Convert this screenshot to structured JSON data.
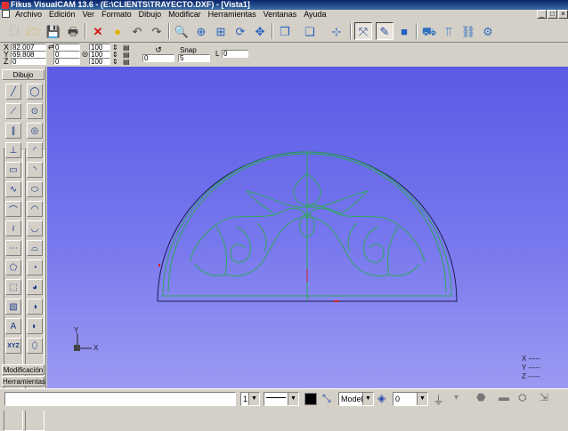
{
  "window": {
    "title": "Fikus VisualCAM 13.6 - (E:\\CLIENTS\\TRAYECTO.DXF) - [Vista1]",
    "controls": [
      "_",
      "□",
      "×"
    ]
  },
  "menu": {
    "items": [
      "Archivo",
      "Edición",
      "Ver",
      "Formato",
      "Dibujo",
      "Modificar",
      "Herramientas",
      "Ventanas",
      "Ayuda"
    ]
  },
  "coords": {
    "x_label": "X",
    "x_value": "82,007",
    "y_label": "Y",
    "y_value": "69,808",
    "z_label": "Z",
    "z_value": "0",
    "col2": [
      "0",
      "0",
      "0"
    ],
    "col3": [
      "100",
      "100",
      "100"
    ],
    "angle_value": "0",
    "snap_label": "Snap",
    "snap_value": "5",
    "l_label": "L",
    "l_value": "0"
  },
  "sidebar": {
    "top_tab": "Dibujo",
    "bottom_tabs": [
      "Modificación",
      "Herramientas"
    ]
  },
  "canvas": {
    "axis_y": "Y",
    "axis_x": "X",
    "readout": [
      "X -----",
      "Y -----",
      "Z -----"
    ]
  },
  "statusbar": {
    "layer_num": "1",
    "view_mode": "Modelo",
    "layer_value": "0"
  },
  "colors": {
    "canvas_top": "#5a5ae6",
    "canvas_bottom": "#9a9af2",
    "drawing_green": "#2fa85a",
    "drawing_outline": "#1a1a50",
    "marker_red": "#d02020"
  }
}
